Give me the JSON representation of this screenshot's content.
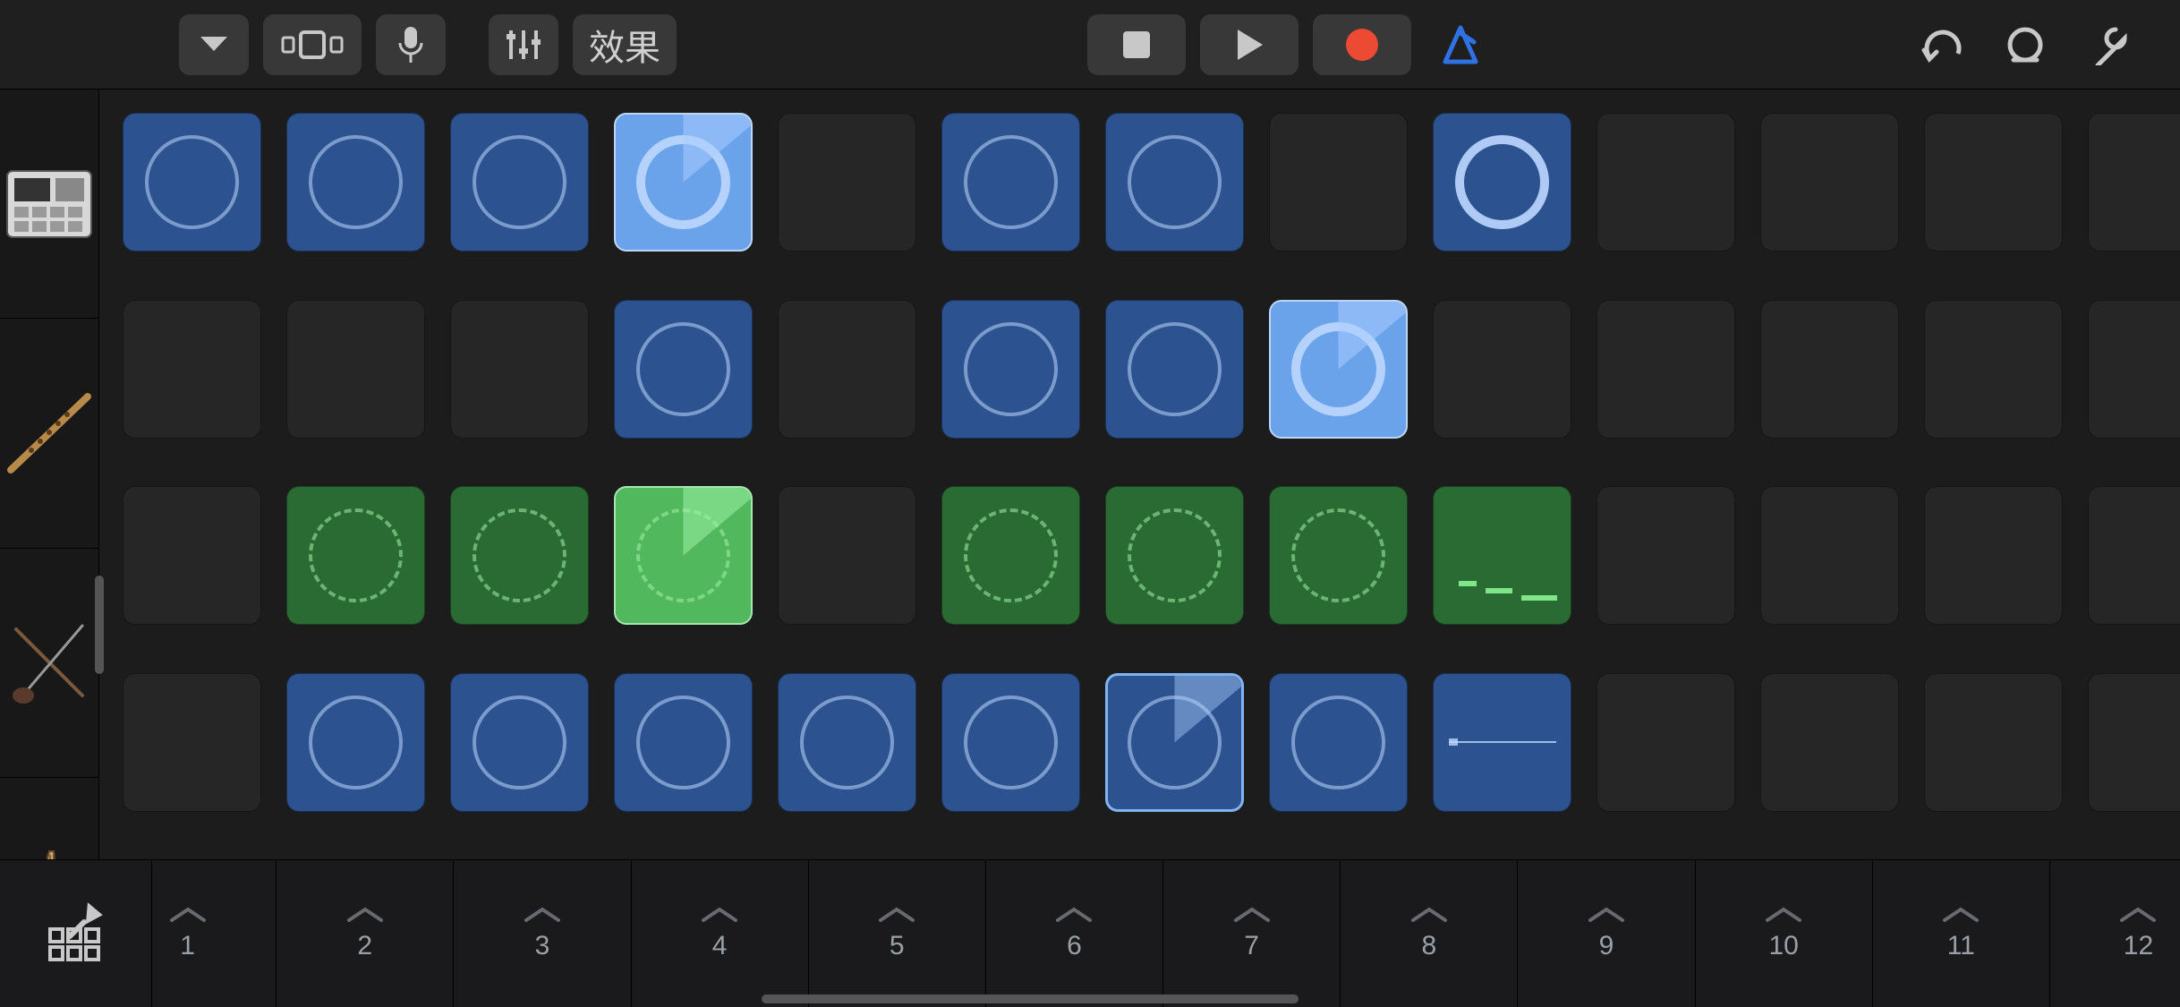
{
  "toolbar": {
    "fx_label": "效果"
  },
  "instruments": [
    {
      "name": "drum-machine"
    },
    {
      "name": "dizi-flute"
    },
    {
      "name": "erhu"
    },
    {
      "name": "pipa"
    }
  ],
  "columns": [
    "1",
    "2",
    "3",
    "4",
    "5",
    "6",
    "7",
    "8",
    "9",
    "10",
    "11",
    "12"
  ],
  "grid": [
    [
      {
        "state": "blue",
        "vis": "wave"
      },
      {
        "state": "blue",
        "vis": "wave"
      },
      {
        "state": "blue",
        "vis": "wave"
      },
      {
        "state": "blue-playing",
        "vis": "wave-thick",
        "wedge": true
      },
      {
        "state": "empty"
      },
      {
        "state": "blue",
        "vis": "wave"
      },
      {
        "state": "blue",
        "vis": "wave"
      },
      {
        "state": "empty"
      },
      {
        "state": "blue",
        "vis": "wave-thick"
      },
      {
        "state": "empty"
      },
      {
        "state": "empty"
      },
      {
        "state": "empty"
      },
      {
        "state": "empty"
      }
    ],
    [
      {
        "state": "empty"
      },
      {
        "state": "empty"
      },
      {
        "state": "empty"
      },
      {
        "state": "blue",
        "vis": "wave"
      },
      {
        "state": "empty"
      },
      {
        "state": "blue",
        "vis": "wave"
      },
      {
        "state": "blue",
        "vis": "wave"
      },
      {
        "state": "blue-playing",
        "vis": "wave-thick",
        "wedge": true
      },
      {
        "state": "empty"
      },
      {
        "state": "empty"
      },
      {
        "state": "empty"
      },
      {
        "state": "empty"
      },
      {
        "state": "empty"
      }
    ],
    [
      {
        "state": "empty"
      },
      {
        "state": "green",
        "vis": "wave"
      },
      {
        "state": "green",
        "vis": "wave"
      },
      {
        "state": "green-playing",
        "vis": "wave",
        "wedge": true
      },
      {
        "state": "empty"
      },
      {
        "state": "green",
        "vis": "wave"
      },
      {
        "state": "green",
        "vis": "wave"
      },
      {
        "state": "green",
        "vis": "wave"
      },
      {
        "state": "green",
        "vis": "steps"
      },
      {
        "state": "empty"
      },
      {
        "state": "empty"
      },
      {
        "state": "empty"
      },
      {
        "state": "empty"
      }
    ],
    [
      {
        "state": "empty"
      },
      {
        "state": "blue",
        "vis": "wave"
      },
      {
        "state": "blue",
        "vis": "wave"
      },
      {
        "state": "blue",
        "vis": "wave"
      },
      {
        "state": "blue",
        "vis": "wave"
      },
      {
        "state": "blue",
        "vis": "wave"
      },
      {
        "state": "blue-selected",
        "vis": "wave",
        "wedge": true
      },
      {
        "state": "blue",
        "vis": "wave"
      },
      {
        "state": "blue",
        "vis": "line"
      },
      {
        "state": "empty"
      },
      {
        "state": "empty"
      },
      {
        "state": "empty"
      },
      {
        "state": "empty"
      }
    ]
  ],
  "colors": {
    "accent_blue": "#3a6fb8",
    "accent_green": "#3a8a44",
    "record_red": "#ec4a33",
    "metronome_blue": "#2e72e6"
  }
}
